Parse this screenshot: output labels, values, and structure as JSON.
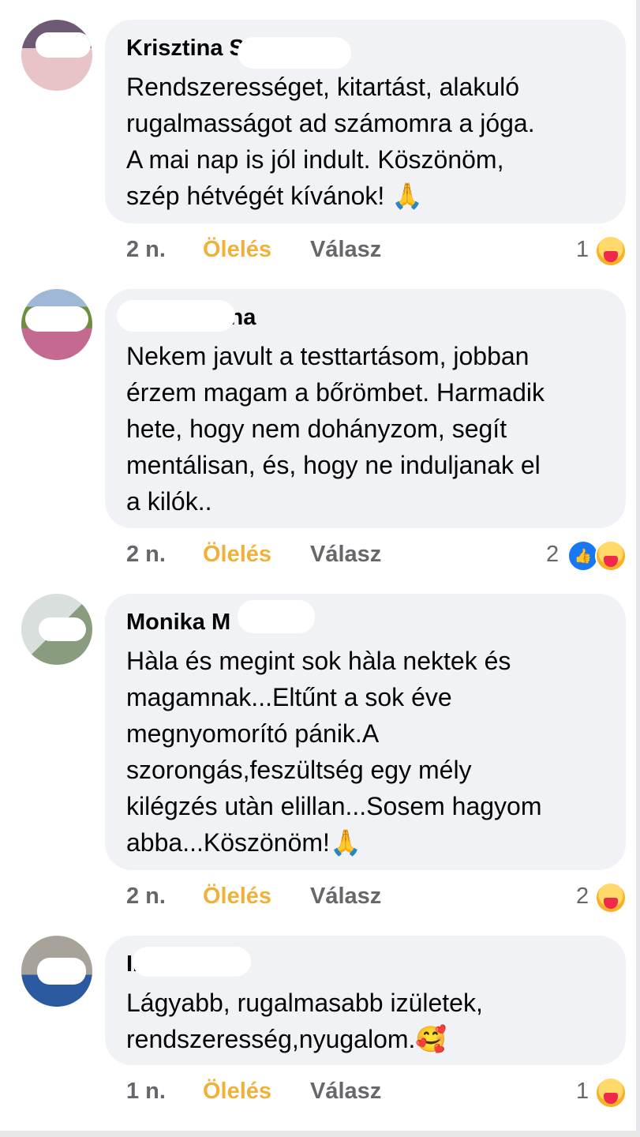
{
  "comments": [
    {
      "author": "Krisztina S",
      "text": "Rendszerességet, kitartást, alakuló\nrugalmasságot ad számomra a jóga.\nA mai nap is jól indult. Köszönöm,\nszép hétvégét kívánok! 🙏",
      "time": "2 n.",
      "hug_label": "Ölelés",
      "reply_label": "Válasz",
      "reaction_count": "1",
      "avatar_colors": [
        "#6f5a76",
        "#e9c4c6"
      ]
    },
    {
      "author": "S...né Edina",
      "text": "Nekem javult a testtartásom, jobban\nérzem magam a bőrömbet. Harmadik\nhete, hogy nem dohányzom, segít\nmentálisan, és, hogy ne induljanak el\na kilók..",
      "time": "2 n.",
      "hug_label": "Ölelés",
      "reply_label": "Válasz",
      "reaction_count": "2",
      "avatar_colors": [
        "#6b8f3e",
        "#c46a90"
      ]
    },
    {
      "author": "Monika M",
      "text": "Hàla és megint sok hàla nektek és\nmagamnak...Eltűnt a sok éve\nmegnyomorító pánik.A\nszorongás,feszültség egy mély\nkilégzés utàn elillan...Sosem hagyom\nabba...Köszönöm!🙏",
      "time": "2 n.",
      "hug_label": "Ölelés",
      "reply_label": "Válasz",
      "reaction_count": "2",
      "avatar_colors": [
        "#c7d0cc",
        "#8a9c7e"
      ]
    },
    {
      "author": "I...tti",
      "text": "Lágyabb, rugalmasabb izületek,\nrendszeresség,nyugalom.🥰",
      "time": "1 n.",
      "hug_label": "Ölelés",
      "reply_label": "Válasz",
      "reaction_count": "1",
      "avatar_colors": [
        "#a7a39a",
        "#2c5aa0"
      ]
    }
  ],
  "icons": {
    "care": "care-reaction-icon",
    "like": "like-reaction-icon"
  },
  "colors": {
    "bubble": "#f0f2f5",
    "hug": "#f0b13a",
    "muted": "#65676b",
    "like": "#1877f2"
  }
}
